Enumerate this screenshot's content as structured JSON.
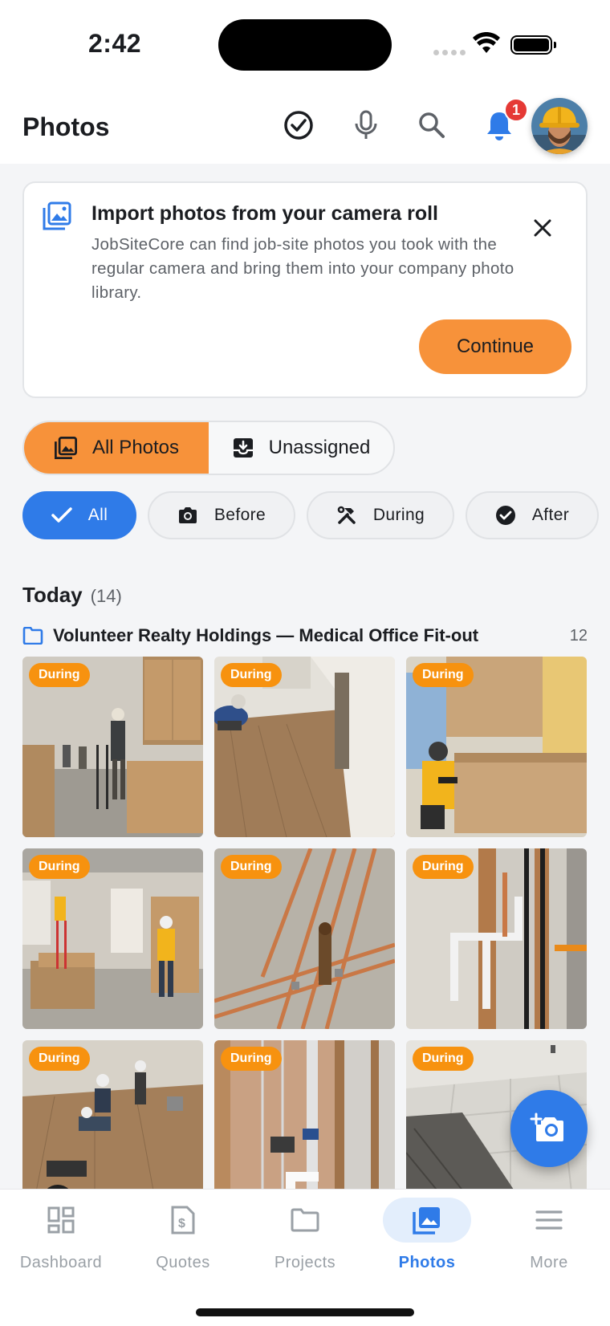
{
  "status": {
    "time": "2:42"
  },
  "header": {
    "title": "Photos",
    "notification_count": "1"
  },
  "import_card": {
    "title": "Import photos from your camera roll",
    "body": "JobSiteCore can find job-site photos you took with the regular camera and bring them into your company photo library.",
    "continue_label": "Continue"
  },
  "segment": {
    "all_photos": "All Photos",
    "unassigned": "Unassigned"
  },
  "filters": {
    "all": "All",
    "before": "Before",
    "during": "During",
    "after": "After"
  },
  "today": {
    "label": "Today",
    "count": "(14)"
  },
  "project": {
    "name": "Volunteer Realty Holdings — Medical Office Fit-out",
    "count": "12"
  },
  "photos": [
    {
      "tag": "During"
    },
    {
      "tag": "During"
    },
    {
      "tag": "During"
    },
    {
      "tag": "During"
    },
    {
      "tag": "During"
    },
    {
      "tag": "During"
    },
    {
      "tag": "During"
    },
    {
      "tag": "During"
    },
    {
      "tag": "During"
    }
  ],
  "nav": {
    "dashboard": "Dashboard",
    "quotes": "Quotes",
    "projects": "Projects",
    "photos": "Photos",
    "more": "More"
  },
  "colors": {
    "accent": "#2f7be8",
    "orange": "#f7923a",
    "tag": "#f7920f",
    "badge": "#e53935"
  }
}
